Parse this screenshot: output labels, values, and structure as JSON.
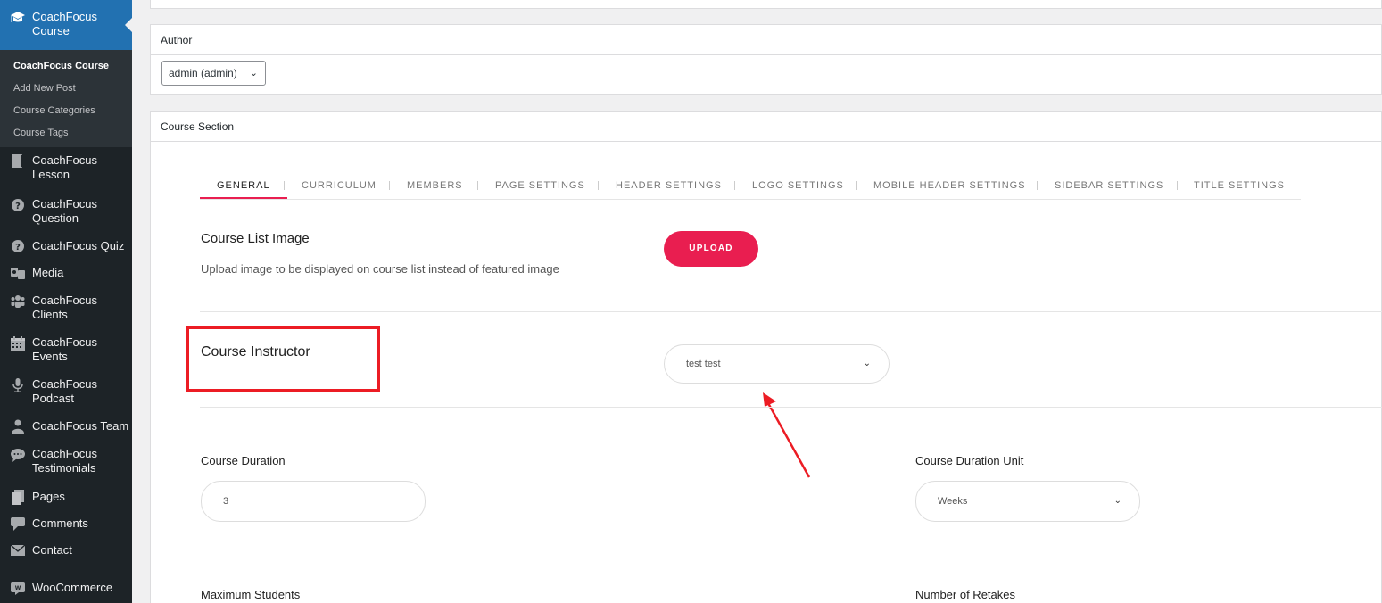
{
  "sidebar": {
    "current": {
      "label": "CoachFocus Course",
      "icon": "graduation-cap-icon"
    },
    "submenu": [
      {
        "label": "CoachFocus Course",
        "current": true
      },
      {
        "label": "Add New Post"
      },
      {
        "label": "Course Categories"
      },
      {
        "label": "Course Tags"
      }
    ],
    "items": [
      {
        "label": "CoachFocus Lesson",
        "icon": "book-icon"
      },
      {
        "label": "CoachFocus Question",
        "icon": "question-circle-icon"
      },
      {
        "label": "CoachFocus Quiz",
        "icon": "question-circle-icon"
      },
      {
        "label": "Media",
        "icon": "media-icon"
      },
      {
        "label": "CoachFocus Clients",
        "icon": "users-icon"
      },
      {
        "label": "CoachFocus Events",
        "icon": "calendar-icon"
      },
      {
        "label": "CoachFocus Podcast",
        "icon": "microphone-icon"
      },
      {
        "label": "CoachFocus Team",
        "icon": "person-icon"
      },
      {
        "label": "CoachFocus Testimonials",
        "icon": "speech-bubble-icon"
      },
      {
        "label": "Pages",
        "icon": "pages-icon"
      },
      {
        "label": "Comments",
        "icon": "comment-icon"
      },
      {
        "label": "Contact",
        "icon": "envelope-icon"
      },
      {
        "label": "WooCommerce",
        "icon": "woocommerce-icon"
      }
    ]
  },
  "author": {
    "heading": "Author",
    "value": "admin (admin)"
  },
  "course_section": {
    "heading": "Course Section",
    "tabs": [
      "GENERAL",
      "CURRICULUM",
      "MEMBERS",
      "PAGE SETTINGS",
      "HEADER SETTINGS",
      "LOGO SETTINGS",
      "MOBILE HEADER SETTINGS",
      "SIDEBAR SETTINGS",
      "TITLE SETTINGS"
    ],
    "active_tab": "GENERAL",
    "list_image": {
      "title": "Course List Image",
      "description": "Upload image to be displayed on course list instead of featured image",
      "button": "UPLOAD"
    },
    "instructor": {
      "title": "Course Instructor",
      "value": "test test"
    },
    "duration": {
      "label": "Course Duration",
      "value": "3"
    },
    "duration_unit": {
      "label": "Course Duration Unit",
      "value": "Weeks"
    },
    "max_students": {
      "label": "Maximum Students"
    },
    "retakes": {
      "label": "Number of Retakes"
    }
  },
  "colors": {
    "accent": "#e91e50",
    "annotation": "#ec1c24",
    "sidebar_bg": "#1d2327",
    "sidebar_active": "#2271b1"
  }
}
